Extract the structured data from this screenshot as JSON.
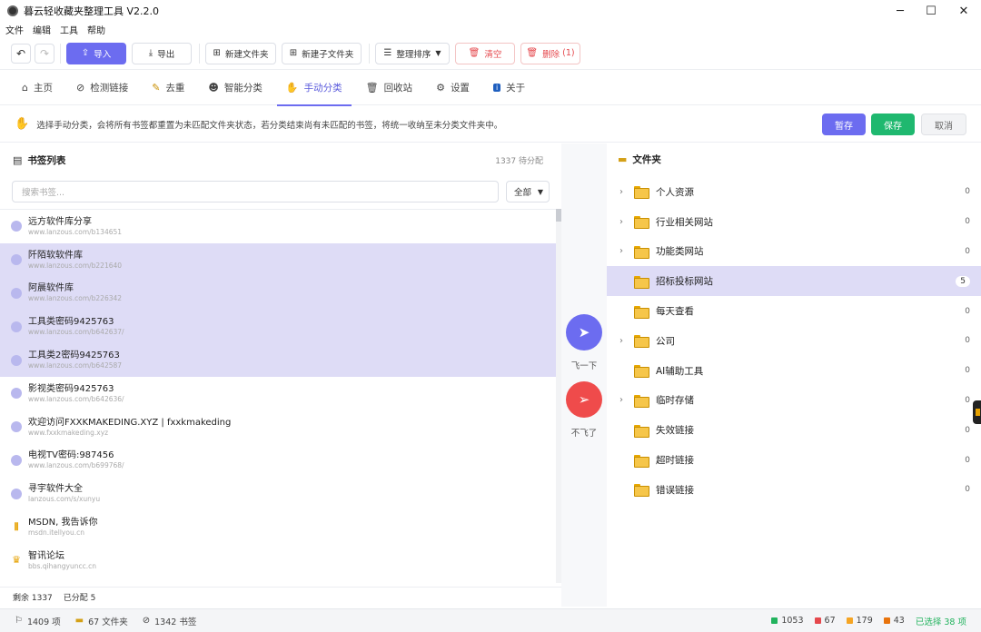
{
  "window": {
    "title": "暮云轻收藏夹整理工具 V2.2.0",
    "controls": {
      "minimize": "─",
      "maximize": "☐",
      "close": "✕"
    }
  },
  "menu": [
    "文件",
    "编辑",
    "工具",
    "帮助"
  ],
  "toolbar": {
    "undo": "↶",
    "redo": "↷",
    "import_label": "导入",
    "export_label": "导出",
    "new_folder_label": "新建文件夹",
    "new_subfolder_label": "新建子文件夹",
    "sort_label": "整理排序",
    "clear_label": "清空",
    "delete_label": "删除",
    "delete_count": "(1)"
  },
  "tabs": [
    {
      "label": "主页",
      "icon": "home-icon"
    },
    {
      "label": "检测链接",
      "icon": "link-check-icon"
    },
    {
      "label": "去重",
      "icon": "broom-icon"
    },
    {
      "label": "智能分类",
      "icon": "robot-icon"
    },
    {
      "label": "手动分类",
      "icon": "hand-icon",
      "active": true
    },
    {
      "label": "回收站",
      "icon": "trash-icon"
    },
    {
      "label": "设置",
      "icon": "gear-icon"
    },
    {
      "label": "关于",
      "icon": "info-icon"
    }
  ],
  "notice": {
    "text": "选择手动分类，会将所有书签都重置为未匹配文件夹状态，若分类结束尚有未匹配的书签，将统一收纳至未分类文件夹中。",
    "pause_label": "暂存",
    "save_label": "保存",
    "cancel_label": "取消",
    "colors": {
      "pause": "#6c6cf0",
      "save": "#1fb86f"
    }
  },
  "bookmarks_panel": {
    "title": "书签列表",
    "pending": "1337 待分配",
    "search_placeholder": "搜索书签...",
    "filter_value": "全部",
    "items": [
      {
        "title": "远方软件库分享",
        "url": "www.lanzous.com/b134651",
        "selected": false
      },
      {
        "title": "阡陌软软件库",
        "url": "www.lanzous.com/b221640",
        "selected": true
      },
      {
        "title": "阿晨软件库",
        "url": "www.lanzous.com/b226342",
        "selected": true
      },
      {
        "title": "工具类密码9425763",
        "url": "www.lanzous.com/b642637/",
        "selected": true
      },
      {
        "title": "工具类2密码9425763",
        "url": "www.lanzous.com/b642587",
        "selected": true
      },
      {
        "title": "影视类密码9425763",
        "url": "www.lanzous.com/b642636/",
        "selected": false
      },
      {
        "title": "欢迎访问FXXKMAKEDING.XYZ | fxxkmakeding",
        "url": "www.fxxkmakeding.xyz",
        "selected": false
      },
      {
        "title": "电视TV密码:987456",
        "url": "www.lanzous.com/b699768/",
        "selected": false
      },
      {
        "title": "寻宇软件大全",
        "url": "lanzous.com/s/xunyu",
        "selected": false
      },
      {
        "title": "MSDN, 我告诉你",
        "url": "msdn.itellyou.cn",
        "selected": false,
        "icon": "msdn-icon"
      },
      {
        "title": "智讯论坛",
        "url": "bbs.qihangyuncc.cn",
        "selected": false,
        "icon": "trophy-icon"
      }
    ],
    "footer": {
      "remaining": "剩余 1337",
      "assigned": "已分配 5"
    }
  },
  "middle": {
    "fly_label": "飞一下",
    "nofly_label": "不飞了",
    "colors": {
      "fly": "#6c6cf0",
      "nofly": "#ef4b4b"
    }
  },
  "folders_panel": {
    "title": "文件夹",
    "items": [
      {
        "name": "个人资源",
        "count": "0",
        "expandable": true
      },
      {
        "name": "行业相关网站",
        "count": "0",
        "expandable": true
      },
      {
        "name": "功能类网站",
        "count": "0",
        "expandable": true
      },
      {
        "name": "招标投标网站",
        "count": "5",
        "expandable": false,
        "selected": true
      },
      {
        "name": "每天查看",
        "count": "0",
        "expandable": false
      },
      {
        "name": "公司",
        "count": "0",
        "expandable": true
      },
      {
        "name": "AI辅助工具",
        "count": "0",
        "expandable": false
      },
      {
        "name": "临时存储",
        "count": "0",
        "expandable": true
      },
      {
        "name": "失效链接",
        "count": "0",
        "expandable": false
      },
      {
        "name": "超时链接",
        "count": "0",
        "expandable": false
      },
      {
        "name": "错误链接",
        "count": "0",
        "expandable": false
      }
    ]
  },
  "statusbar": {
    "items": "1409 项",
    "folders": "67 文件夹",
    "bookmarks": "1342 书签",
    "stat_green": "1053",
    "stat_red": "67",
    "stat_orange": "179",
    "stat_darkorange": "43",
    "selected": "已选择 38 项",
    "colors": {
      "green": "#22b35e",
      "red": "#e5484d",
      "orange": "#f5a524",
      "darkorange": "#e8730c"
    }
  }
}
